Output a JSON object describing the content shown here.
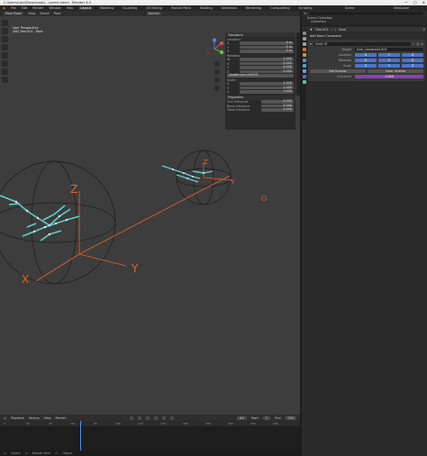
{
  "window": {
    "title": "C:\\Users\\user\\Downloads\\...\\scene.blend - Blender 4.0",
    "buttons": [
      "—",
      "□",
      "✕"
    ]
  },
  "menu": {
    "items": [
      "File",
      "Edit",
      "Render",
      "Window",
      "Help"
    ],
    "workspaces": [
      "Layout",
      "Modeling",
      "Sculpting",
      "UV Editing",
      "Texture Paint",
      "Shading",
      "Animation",
      "Rendering",
      "Compositing",
      "Scripting"
    ],
    "active_workspace": "Layout",
    "scene": "Scene",
    "view_layer": "ViewLayer"
  },
  "viewport": {
    "mode": "Pose Mode",
    "menus": [
      "View",
      "Select",
      "Pose"
    ],
    "orientation": "Normal",
    "overlay": [
      "User Perspective",
      "(84) Tree.001 : Root"
    ],
    "axis_labels": {
      "x": "X",
      "y": "Y",
      "z": "Z"
    },
    "colors": {
      "background": "#3d3d3d",
      "axis_orange": "#e8632a",
      "bones": "#5fd0c8"
    }
  },
  "n_panel": {
    "transform_title": "Transform",
    "location_title": "Location:",
    "rotation_title": "Rotation:",
    "mode_title": "Quaternion (WXYZ)",
    "scale_title": "Scale:",
    "properties_title": "Properties",
    "location": [
      {
        "axis": "X",
        "value": "0 m"
      },
      {
        "axis": "Y",
        "value": "0 m"
      },
      {
        "axis": "Z",
        "value": "0 m"
      }
    ],
    "rotation": [
      {
        "axis": "W",
        "value": "1.000"
      },
      {
        "axis": "X",
        "value": "0.000"
      },
      {
        "axis": "Y",
        "value": "0.000"
      },
      {
        "axis": "Z",
        "value": "0.000"
      }
    ],
    "scale": [
      {
        "axis": "X",
        "value": "1.000"
      },
      {
        "axis": "Y",
        "value": "1.000"
      },
      {
        "axis": "Z",
        "value": "1.000"
      }
    ],
    "properties": [
      {
        "label": "Curl Influence",
        "value": "0.000"
      },
      {
        "label": "Bend Influence",
        "value": "0.000"
      },
      {
        "label": "Twist Influence",
        "value": "0.000"
      }
    ]
  },
  "outliner": {
    "title": "Scene Collection",
    "items": [
      "Scene Collection",
      "Collection"
    ]
  },
  "properties": {
    "breadcrumb": [
      "Tree.001",
      "Root"
    ],
    "add_label": "Add Bone Constraint",
    "constraint_name": "Child Of",
    "target_label": "Target",
    "target_value": "tree_Constraint.001",
    "location_label": "Location",
    "rotation_label": "Rotation",
    "scale_label": "Scale",
    "xyz": [
      "X",
      "Y",
      "Z"
    ],
    "set_inverse": "Set Inverse",
    "clear_inverse": "Clear Inverse",
    "influence_label": "Influence",
    "influence_value": "1.000",
    "colors": {
      "toggle": "#4a74c8",
      "influence": "#8a3fb8"
    }
  },
  "timeline": {
    "menus": [
      "Playback",
      "Keying",
      "View",
      "Marker"
    ],
    "current_frame": "84",
    "start_label": "Start",
    "start": "1",
    "end_label": "End",
    "end": "250",
    "ruler": [
      "0",
      "20",
      "40",
      "60",
      "80",
      "100",
      "120",
      "140",
      "160",
      "180",
      "200",
      "220",
      "240"
    ]
  },
  "statusbar": {
    "items": [
      "Select",
      "Rotate View",
      "Object"
    ]
  }
}
